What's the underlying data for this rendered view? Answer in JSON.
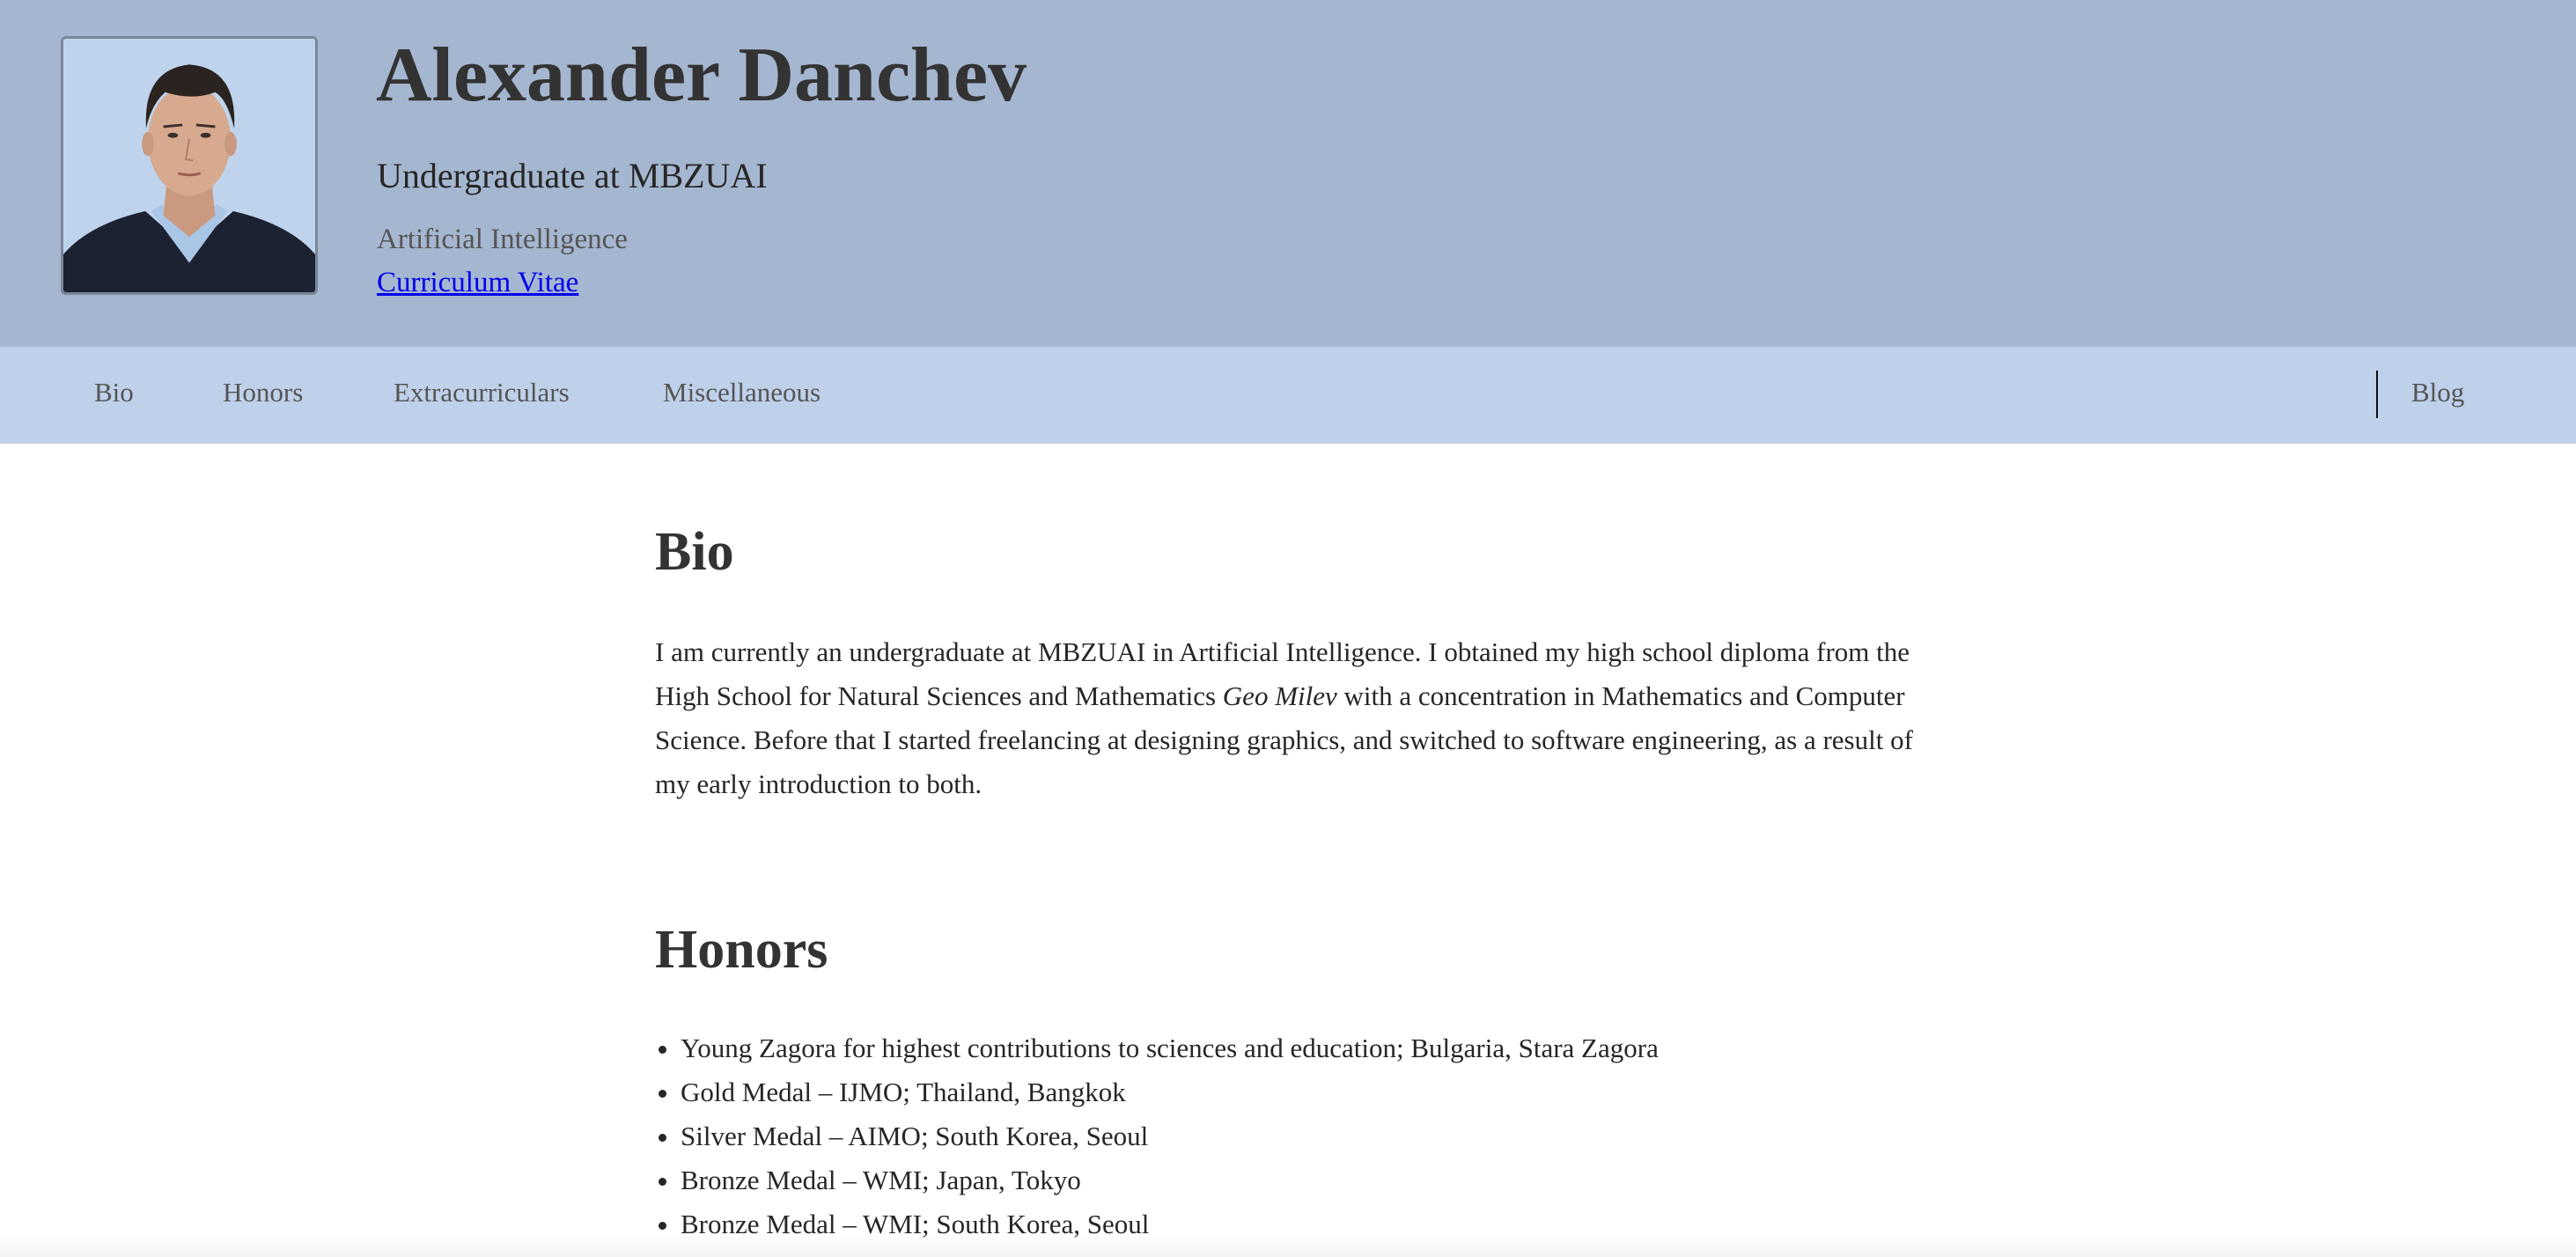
{
  "header": {
    "name": "Alexander Danchev",
    "position": "Undergraduate at MBZUAI",
    "field": "Artificial Intelligence",
    "cv_link": "Curriculum Vitae"
  },
  "nav": {
    "items": [
      {
        "label": "Bio"
      },
      {
        "label": "Honors"
      },
      {
        "label": "Extracurriculars"
      },
      {
        "label": "Miscellaneous"
      }
    ],
    "blog": "Blog"
  },
  "bio": {
    "title": "Bio",
    "text_before": "I am currently an undergraduate at MBZUAI in Artificial Intelligence. I obtained my high school diploma from the High School for Natural Sciences and Mathematics ",
    "school_name": "Geo Milev",
    "text_after": " with a concentration in Mathematics and Computer Science. Before that I started freelancing at designing graphics, and switched to software engineering, as a result of my early introduction to both."
  },
  "honors": {
    "title": "Honors",
    "items": [
      "Young Zagora for highest contributions to sciences and education; Bulgaria, Stara Zagora",
      "Gold Medal – IJMO; Thailand, Bangkok",
      "Silver Medal – AIMO; South Korea, Seoul",
      "Bronze Medal – WMI; Japan, Tokyo",
      "Bronze Medal – WMI; South Korea, Seoul"
    ]
  },
  "colors": {
    "header_bg": "#a5b6d0",
    "nav_bg": "#bfd0ea",
    "link": "#0000ee",
    "heading": "#333333"
  }
}
